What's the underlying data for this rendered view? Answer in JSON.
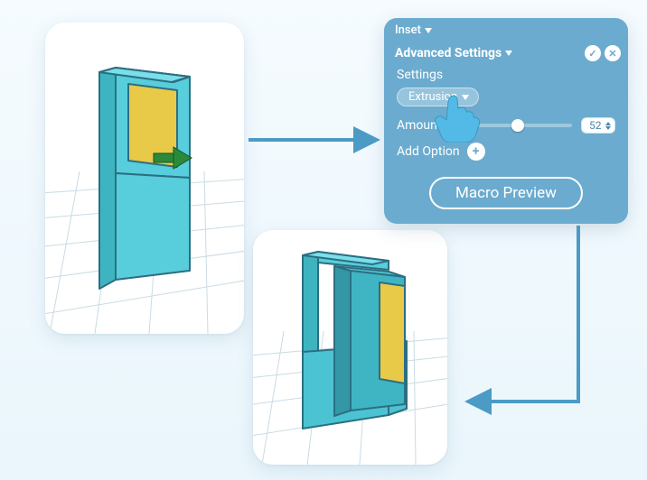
{
  "panel": {
    "header_label": "Inset",
    "advanced_label": "Advanced Settings",
    "settings_label": "Settings",
    "option_pill_label": "Extrusion",
    "amount_label": "Amount",
    "amount_value": "52",
    "slider_percent": 52,
    "add_option_label": "Add Option",
    "macro_btn_label": "Macro Preview"
  },
  "icons": {
    "confirm": "✓",
    "cancel": "✕",
    "plus": "+"
  },
  "viewports": {
    "card1_desc": "3D cuboid model with yellow inset face and green move gizmo on checkered floor",
    "card2_desc": "3D cuboid model with extruded yellow face, larger base, on checkered floor"
  },
  "colors": {
    "accent": "#6babcf",
    "model_face": "#53c7d1",
    "model_inset": "#e6c945",
    "arrow": "#4b9bc6",
    "gizmo": "#2a8a3a"
  }
}
